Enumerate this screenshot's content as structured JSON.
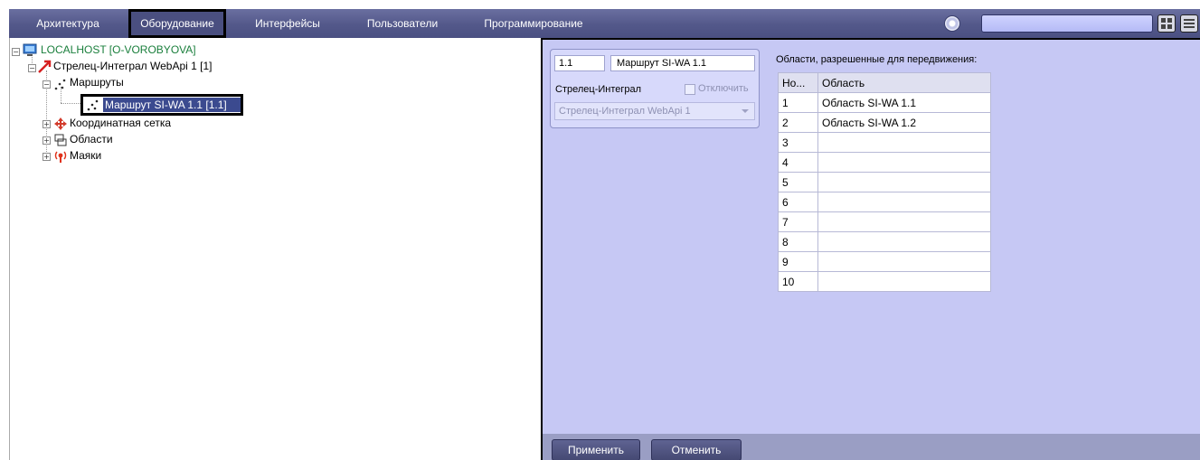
{
  "menu": {
    "tabs": [
      {
        "label": "Архитектура"
      },
      {
        "label": "Оборудование",
        "active": true
      },
      {
        "label": "Интерфейсы"
      },
      {
        "label": "Пользователи"
      },
      {
        "label": "Программирование"
      }
    ],
    "search_value": ""
  },
  "tree": {
    "root": "LOCALHOST [O-VOROBYOVA]",
    "device": "Стрелец-Интеграл WebApi 1 [1]",
    "routes": "Маршруты",
    "route_item": "Маршрут SI-WA 1.1 [1.1]",
    "grid": "Координатная сетка",
    "areas": "Области",
    "beacons": "Маяки"
  },
  "props": {
    "number": "1.1",
    "name": "Маршрут SI-WA 1.1",
    "device_label": "Стрелец-Интеграл",
    "disable_label": "Отключить",
    "disable_checked": false,
    "device_select": "Стрелец-Интеграл WebApi 1"
  },
  "areas": {
    "title": "Области, разрешенные для передвижения:",
    "columns": [
      "Но...",
      "Область"
    ],
    "rows": [
      [
        "1",
        "Область SI-WA 1.1"
      ],
      [
        "2",
        "Область SI-WA 1.2"
      ],
      [
        "3",
        ""
      ],
      [
        "4",
        ""
      ],
      [
        "5",
        ""
      ],
      [
        "6",
        ""
      ],
      [
        "7",
        ""
      ],
      [
        "8",
        ""
      ],
      [
        "9",
        ""
      ],
      [
        "10",
        ""
      ]
    ]
  },
  "buttons": {
    "apply": "Применить",
    "cancel": "Отменить"
  },
  "colors": {
    "menubar": "#53588a",
    "panel": "#c6c8f4",
    "selection": "#3b4a8f",
    "root_text": "#1a7f3c"
  }
}
